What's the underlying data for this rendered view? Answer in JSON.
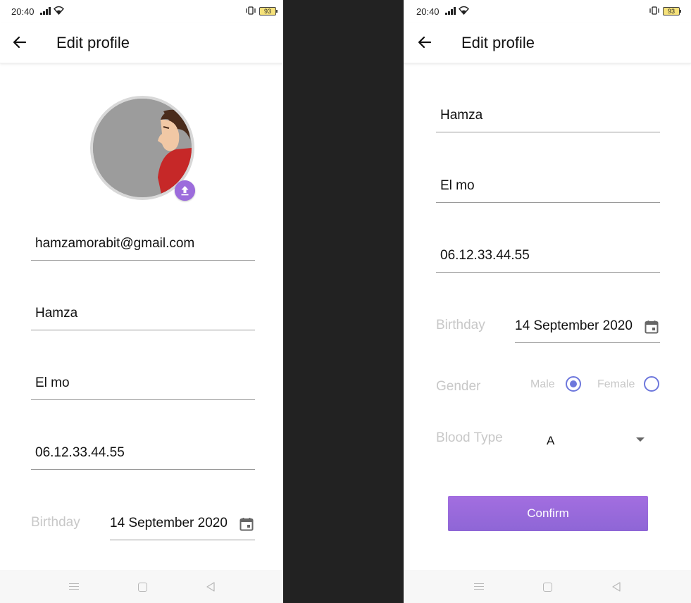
{
  "status_bar": {
    "time": "20:40",
    "battery": "93"
  },
  "left_screen": {
    "title": "Edit profile",
    "email": "hamzamorabit@gmail.com",
    "first_name": "Hamza",
    "last_name": "El mo",
    "phone": "06.12.33.44.55",
    "birthday_label": "Birthday",
    "birthday_value": "14 September 2020"
  },
  "right_screen": {
    "title": "Edit profile",
    "first_name": "Hamza",
    "last_name": "El mo",
    "phone": "06.12.33.44.55",
    "birthday_label": "Birthday",
    "birthday_value": "14 September 2020",
    "gender_label": "Gender",
    "gender_options": [
      "Male",
      "Female"
    ],
    "gender_selected": "Male",
    "blood_type_label": "Blood Type",
    "blood_type_value": "A",
    "confirm_label": "Confirm"
  },
  "icons": {
    "back": "arrow-left-icon",
    "upload": "upload-icon",
    "calendar": "calendar-icon",
    "dropdown": "chevron-down-icon",
    "nav_menu": "menu-icon",
    "nav_home": "square-home-icon",
    "nav_back": "triangle-back-icon"
  },
  "colors": {
    "accent": "#9c6cdc",
    "radio": "#6e78dc",
    "label_muted": "#c8c8c8",
    "divider": "#9a9a9a",
    "gutter": "#222222"
  }
}
